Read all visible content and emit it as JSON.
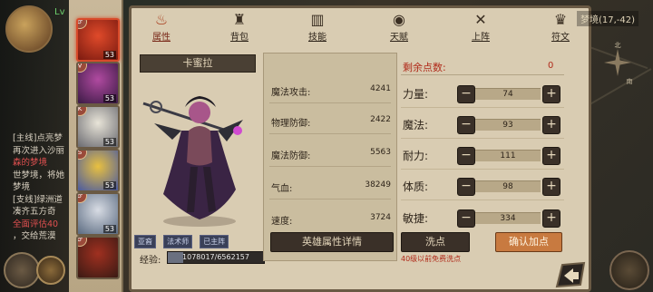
{
  "tabs": [
    {
      "label": "属性",
      "icon": "flame-icon",
      "active": true
    },
    {
      "label": "背包",
      "icon": "bag-icon",
      "active": false
    },
    {
      "label": "技能",
      "icon": "book-icon",
      "active": false
    },
    {
      "label": "天赋",
      "icon": "eye-icon",
      "active": false
    },
    {
      "label": "上阵",
      "icon": "swords-icon",
      "active": false
    },
    {
      "label": "符文",
      "icon": "rune-icon",
      "active": false
    }
  ],
  "left_log": {
    "level": "Lv",
    "lines": [
      {
        "text": "[主线]点亮梦",
        "color": "default"
      },
      {
        "text": "再次进入沙丽",
        "color": "default"
      },
      {
        "text": "森的梦境",
        "color": "red"
      },
      {
        "text": "世梦境，将她",
        "color": "default"
      },
      {
        "text": "梦境",
        "color": "default"
      },
      {
        "text": "[支线]绿洲道",
        "color": "default"
      },
      {
        "text": "凑齐五方奇",
        "color": "default"
      },
      {
        "text": "全面评估40",
        "color": "red"
      },
      {
        "text": "，交给荒漠",
        "color": "default"
      }
    ]
  },
  "heroes": [
    {
      "level": "53",
      "tag": "♂",
      "active": true
    },
    {
      "level": "53",
      "tag": "♀",
      "active": false
    },
    {
      "level": "53",
      "tag": "K",
      "active": false
    },
    {
      "level": "53",
      "tag": "S",
      "active": false
    },
    {
      "level": "53",
      "tag": "♂",
      "active": false
    },
    {
      "level": "",
      "tag": "♂",
      "active": false
    }
  ],
  "hero": {
    "name": "卡蜜拉",
    "badges": [
      "亚裔",
      "法术师",
      "已主阵"
    ],
    "exp_label": "经验:",
    "exp_text": "1078017/6562157",
    "exp_fraction": 0.164
  },
  "stats": [
    {
      "label": "魔法攻击:",
      "value": "4241"
    },
    {
      "label": "物理防御:",
      "value": "2422"
    },
    {
      "label": "魔法防御:",
      "value": "5563"
    },
    {
      "label": "气血:",
      "value": "38249"
    },
    {
      "label": "速度:",
      "value": "3724"
    }
  ],
  "detail_button": "英雄属性详情",
  "allocation": {
    "remain_label": "剩余点数:",
    "remain_value": "0",
    "rows": [
      {
        "label": "力量:",
        "value": "74"
      },
      {
        "label": "魔法:",
        "value": "93"
      },
      {
        "label": "耐力:",
        "value": "111"
      },
      {
        "label": "体质:",
        "value": "98"
      },
      {
        "label": "敏捷:",
        "value": "334"
      }
    ],
    "minus": "−",
    "plus": "+"
  },
  "wash_button": "洗点",
  "confirm_button": "确认加点",
  "free_note": "40级以前免费洗点",
  "coord": "梦境(17,-42)",
  "compass": {
    "n": "北",
    "s": "南"
  }
}
